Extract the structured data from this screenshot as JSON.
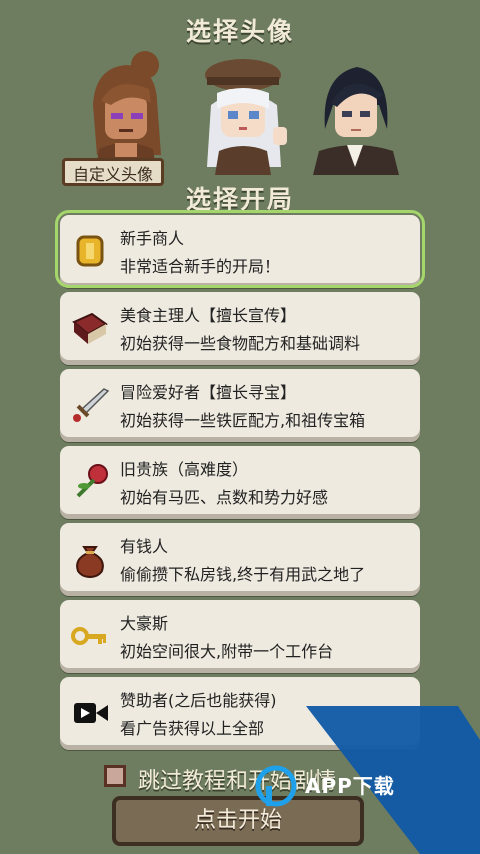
{
  "header": {
    "avatar_title": "选择头像",
    "start_title": "选择开局"
  },
  "avatar": {
    "custom_label": "自定义头像"
  },
  "options": [
    {
      "name": "新手商人",
      "desc": "非常适合新手的开局！",
      "icon": "gold-coin-icon"
    },
    {
      "name": "美食主理人【擅长宣传】",
      "desc": "初始获得一些食物配方和基础调料",
      "icon": "cookbook-icon"
    },
    {
      "name": "冒险爱好者【擅长寻宝】",
      "desc": "初始获得一些铁匠配方,和祖传宝箱",
      "icon": "sword-icon"
    },
    {
      "name": "旧贵族（高难度）",
      "desc": "初始有马匹、点数和势力好感",
      "icon": "rose-icon"
    },
    {
      "name": "有钱人",
      "desc": "偷偷攒下私房钱,终于有用武之地了",
      "icon": "money-bag-icon"
    },
    {
      "name": "大豪斯",
      "desc": "初始空间很大,附带一个工作台",
      "icon": "key-icon"
    },
    {
      "name": "赞助者(之后也能获得)",
      "desc": "看广告获得以上全部",
      "icon": "video-camera-icon"
    }
  ],
  "skip": {
    "label": "跳过教程和开始剧情"
  },
  "start_button": {
    "label": "点击开始"
  },
  "watermark": {
    "text": "APP下载"
  }
}
